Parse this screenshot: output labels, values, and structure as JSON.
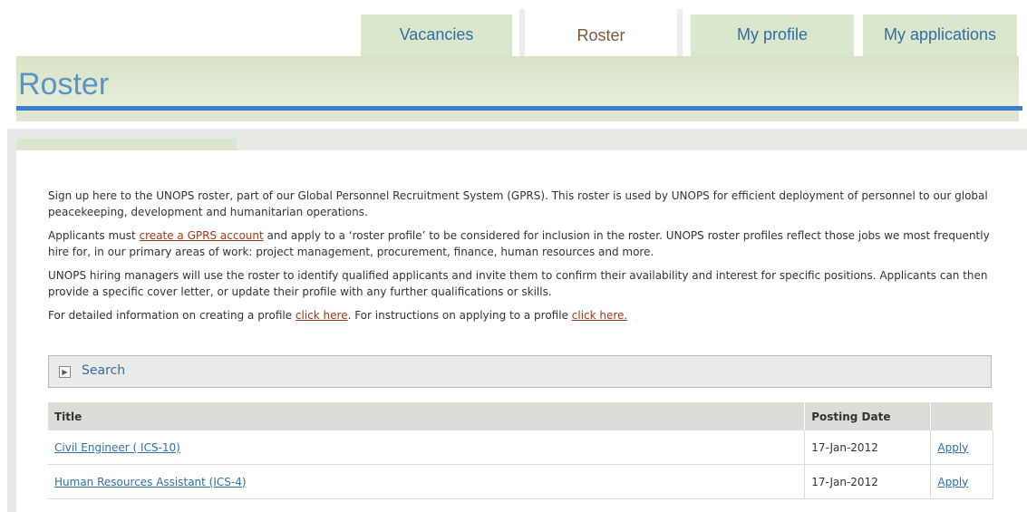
{
  "nav": {
    "tabs": [
      {
        "label": "Vacancies"
      },
      {
        "label": "Roster"
      },
      {
        "label": "My profile"
      },
      {
        "label": "My applications"
      }
    ]
  },
  "page": {
    "title": "Roster"
  },
  "intro": {
    "p1": "Sign up here to the UNOPS roster, part of our Global Personnel Recruitment System (GPRS). This roster is used by UNOPS for efficient deployment of personnel to our global peacekeeping, development and humanitarian operations.",
    "p2_before": "Applicants must ",
    "p2_link": "create a GPRS account",
    "p2_after": " and apply to a ‘roster profile’ to be considered for inclusion in the roster. UNOPS roster profiles reflect those jobs we most frequently hire for, in our primary areas of work: project management, procurement, finance, human resources and more.",
    "p3": "UNOPS hiring managers will use the roster to identify qualified applicants and invite them to confirm their availability and interest for specific positions. Applicants can then provide a specific cover letter, or update their profile with any further qualifications or skills.",
    "p4_before": "For detailed information on creating a profile ",
    "p4_link1": "click here",
    "p4_middle": ". For instructions on applying to a profile ",
    "p4_link2": "click here."
  },
  "search": {
    "label": "Search"
  },
  "table": {
    "headers": {
      "title": "Title",
      "date": "Posting Date",
      "action": ""
    },
    "rows": [
      {
        "title": "Civil Engineer ( ICS-10)",
        "date": "17-Jan-2012",
        "action": "Apply"
      },
      {
        "title": "Human Resources Assistant (ICS-4)",
        "date": "17-Jan-2012",
        "action": "Apply"
      }
    ]
  }
}
